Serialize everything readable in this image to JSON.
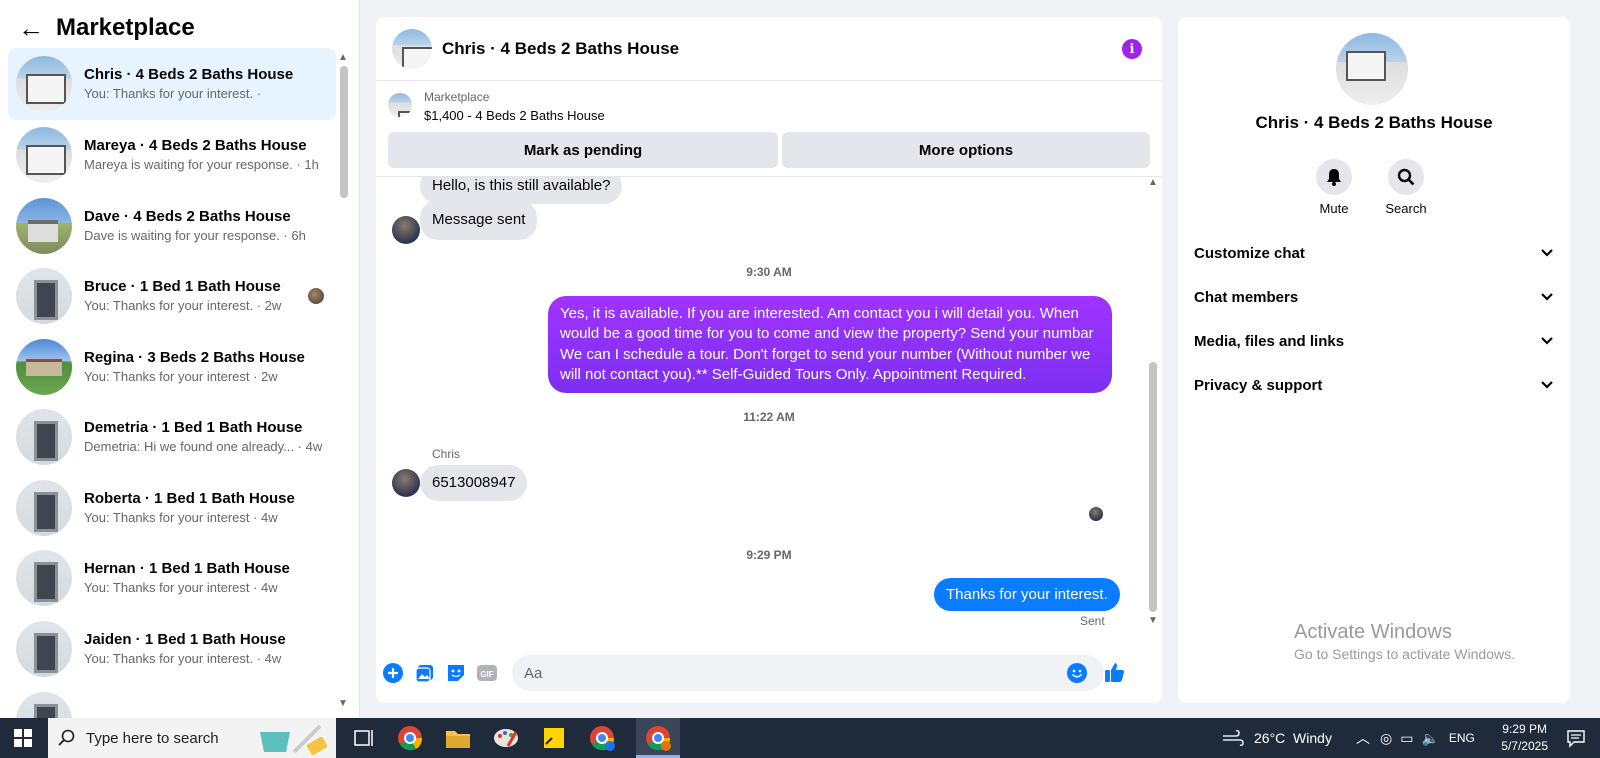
{
  "sidebar": {
    "back_symbol": "←",
    "title": "Marketplace",
    "conversations": [
      {
        "name": "Chris · 4 Beds 2 Baths House",
        "preview": "You: Thanks for your interest. ·",
        "thumb": "house-a",
        "active": true
      },
      {
        "name": "Mareya · 4 Beds 2 Baths House",
        "preview": "Mareya is waiting for your response. · 1h",
        "thumb": "house-a"
      },
      {
        "name": "Dave · 4 Beds 2 Baths House",
        "preview": "Dave is waiting for your response. · 6h",
        "thumb": "house-b"
      },
      {
        "name": "Bruce · 1 Bed 1 Bath House",
        "preview": "You: Thanks for your interest. · 2w",
        "thumb": "house-c",
        "seen_avatar": true
      },
      {
        "name": "Regina · 3 Beds 2 Baths House",
        "preview": "You: Thanks for your interest · 2w",
        "thumb": "house-d"
      },
      {
        "name": "Demetria · 1 Bed 1 Bath House",
        "preview": "Demetria: Hi we found one already... · 4w",
        "thumb": "house-c"
      },
      {
        "name": "Roberta · 1 Bed 1 Bath House",
        "preview": "You: Thanks for your interest · 4w",
        "thumb": "house-c"
      },
      {
        "name": "Hernan · 1 Bed 1 Bath House",
        "preview": "You: Thanks for your interest · 4w",
        "thumb": "house-c"
      },
      {
        "name": "Jaiden · 1 Bed 1 Bath House",
        "preview": "You: Thanks for your interest. · 4w",
        "thumb": "house-c"
      },
      {
        "name": "",
        "preview": "",
        "thumb": "house-c"
      }
    ]
  },
  "chat": {
    "title": "Chris · 4 Beds 2 Baths House",
    "info_symbol": "i",
    "listing": {
      "source": "Marketplace",
      "price_line": "$1,400 - 4 Beds 2 Baths House",
      "mark_pending_label": "Mark as pending",
      "more_options_label": "More options"
    },
    "messages": {
      "in_1": "Hello, is this still available?",
      "in_2": "Message sent",
      "time_1": "9:30 AM",
      "out_1": "Yes, it is available. If you are interested.  Am contact you i will detail you.  When would be a good time for you to come and view the property? Send your numbar We can I schedule a tour.  Don't forget to send your number (Without number we will not contact you).** Self-Guided Tours Only. Appointment Required.",
      "time_2": "11:22 AM",
      "sender": "Chris",
      "in_3": "6513008947",
      "time_3": "9:29 PM",
      "out_2": "Thanks for your interest.",
      "status": "Sent"
    },
    "composer": {
      "placeholder": "Aa",
      "gif_label": "GIF"
    }
  },
  "details": {
    "name": "Chris · 4 Beds 2 Baths House",
    "mute_label": "Mute",
    "search_label": "Search",
    "sections": [
      "Customize chat",
      "Chat members",
      "Media, files and links",
      "Privacy & support"
    ]
  },
  "watermark": {
    "line1": "Activate Windows",
    "line2": "Go to Settings to activate Windows."
  },
  "taskbar": {
    "search_placeholder": "Type here to search",
    "weather": "26°C  Windy",
    "language": "ENG",
    "time": "9:29 PM",
    "date": "5/7/2025"
  },
  "colors": {
    "accent_purple": "#a020f0",
    "messenger_blue": "#0a7cff",
    "active_row": "#e7f3ff"
  }
}
